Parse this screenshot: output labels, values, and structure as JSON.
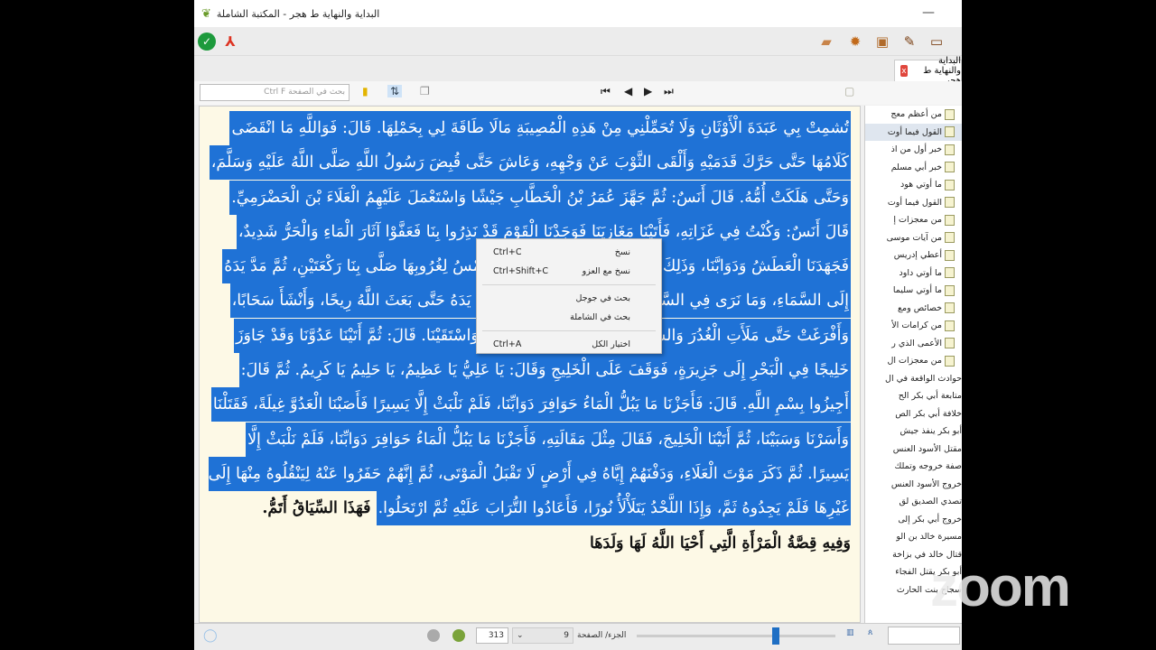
{
  "window": {
    "title": "البداية والنهاية ط هجر - المكتبة الشاملة",
    "minimize": "—"
  },
  "tab": {
    "label": "البداية والنهاية ط هجر",
    "close": "x"
  },
  "search": {
    "placeholder": "بحث في الصفحة Ctrl F"
  },
  "nav": {
    "first": "⏮",
    "prev": "◀",
    "next": "▶",
    "last": "⏭"
  },
  "content": {
    "selected_lines": [
      "تُشمِتْ بِي عَبَدَةَ الْأَوْثَانِ وَلَا تُحَمِّلْنِي مِنْ هَذِهِ الْمُصِيبَةِ مَالَا طَاقَةَ لِي بِحَمْلِهَا. قَالَ: فَوَاللَّهِ مَا انْقَضَى",
      "كَلَامُهَا حَتَّى حَرَّكَ قَدَمَيْهِ وَأَلْقَى الثَّوْبَ عَنْ وَجْهِهِ، وَعَاشَ حَتَّى قُبِضَ رَسُولُ اللَّهِ صَلَّى اللَّهُ عَلَيْهِ وَسَلَّمَ،",
      "وَحَتَّى هَلَكَتْ أُمُّهُ. قَالَ أَنَسٌ: ثُمَّ جَهَّزَ عُمَرُ بْنُ الْخَطَّابِ جَيْشًا وَاسْتَعْمَلَ عَلَيْهِمُ الْعَلَاءَ بْنَ الْحَضْرَمِيِّ.",
      "قَالَ أَنَسٌ: وَكُنْتُ فِي غَزَاتِهِ، فَأَتَيْنَا مَغَازِيَنَا فَوَجَدْنَا الْقَوْمَ قَدْ نَذِرُوا بِنَا فَعَفَّوْا آثَارَ الْمَاءِ وَالْحَرُّ شَدِيدٌ،",
      "فَجَهَدَنَا الْعَطَشُ وَدَوَابَّنَا، وَذَلِكَ يَوْمَ الْجُمُعَةِ، فَلَمَّا مَالَتِ الشَّمْسُ لِغُرُوبِهَا صَلَّى بِنَا رَكْعَتَيْنِ، ثُمَّ مَدَّ يَدَهُ",
      "إِلَى السَّمَاءِ، وَمَا نَرَى فِي السَّمَاءِ شَيْئًا، قَالَ: فَوَاللَّهِ مَا حَطَّ يَدَهُ حَتَّى بَعَثَ اللَّهُ رِيحًا، وَأَنْشَأَ سَحَابًا،",
      "وَأَفْرَغَتْ حَتَّى مَلَأَتِ الْغُدُرَ وَالشِّعَابَ، فَشَرِبْنَا وَسَقَيْنَا رِكَابَنَا وَاسْتَقَيْنَا. قَالَ: ثُمَّ أَتَيْنَا عَدُوَّنَا وَقَدْ جَاوَزَ",
      "خَلِيجًا فِي الْبَحْرِ إِلَى جَزِيرَةٍ، فَوَقَفَ عَلَى الْخَلِيجِ وَقَالَ: يَا عَلِيُّ يَا عَظِيمُ، يَا حَلِيمُ يَا كَرِيمُ. ثُمَّ قَالَ:",
      "أَجِيزُوا بِسْمِ اللَّهِ. قَالَ: فَأَجَزْنَا مَا يَبُلُّ الْمَاءُ حَوَافِرَ دَوَابِّنَا، فَلَمْ نَلْبَثْ إِلَّا يَسِيرًا فَأَصَبْنَا الْعَدُوَّ غِيلَةً، فَقَتَلْنَا",
      "وَأَسَرْنَا وَسَبَيْنَا، ثُمَّ أَتَيْنَا الْخَلِيجَ، فَقَالَ مِثْلَ مَقَالَتِهِ، فَأَجَزْنَا مَا يَبُلُّ الْمَاءُ حَوَافِرَ دَوَابِّنَا، فَلَمْ نَلْبَثْ إِلَّا",
      "يَسِيرًا. ثُمَّ ذَكَرَ مَوْتَ الْعَلَاءِ، وَدَفْنَهُمْ إِيَّاهُ فِي أَرْضٍ لَا تَقْبَلُ الْمَوْتَى، ثُمَّ إِنَّهُمْ حَفَرُوا عَنْهُ لِيَنْقُلُوهُ مِنْهَا إِلَى",
      "غَيْرِهَا فَلَمْ يَجِدُوهُ ثَمَّ، وَإِذَا اللَّحْدُ يَتَلَأْلَأُ نُورًا، فَأَعَادُوا التُّرَابَ عَلَيْهِ ثُمَّ ارْتَحَلُوا."
    ],
    "line12_tail": " فَهَذَا السِّيَاقُ أَتَمُّ.",
    "heading": "وَفِيهِ قِصَّةُ الْمَرْأَةِ الَّتِي أَحْيَا اللَّهُ لَهَا وَلَدَهَا"
  },
  "context_menu": [
    {
      "label": "نسخ",
      "shortcut": "Ctrl+C"
    },
    {
      "label": "نسخ مع العزو",
      "shortcut": "Ctrl+Shift+C"
    },
    {
      "label": "بحث في جوجل",
      "shortcut": ""
    },
    {
      "label": "بحث في الشاملة",
      "shortcut": ""
    },
    {
      "label": "اختيار الكل",
      "shortcut": "Ctrl+A"
    }
  ],
  "sidebar": {
    "doc_items": [
      "من أعظم معج",
      "القول فيما أوت",
      "خبر أول من اذ",
      "خبر أبي مسلم",
      "ما أوتي هود",
      "القول فيما أوت",
      "من معجزات إ",
      "من آيات موسى",
      "أعطي إدريس",
      "ما أوتي داود",
      "ما أوتي سليما",
      "خصائص ومع",
      "من كرامات الأ",
      "الأعمى الذي ر",
      "من معجزات ال"
    ],
    "plain_items": [
      "حوادث الواقعة في ال",
      "متابعة أبي بكر الح",
      "خلافة أبي بكر الص",
      "أبو بكر ينفذ جيش",
      "مقتل الأسود العنس",
      "صفة خروجه وتملك",
      "خروج الأسود العنس",
      "تصدي الصديق لق",
      "خروج أبي بكر إلى",
      "مسيرة خالد بن الو",
      "قتال خالد في بزاخة",
      "أبو بكر يقتل الفجاء",
      "سجاح بنت الحارث"
    ],
    "active_index": 1
  },
  "status": {
    "page": "313",
    "part": "9",
    "part_page_label": "الجزء/ الصفحة",
    "slider_fraction": 0.7
  },
  "watermark": "zoom"
}
